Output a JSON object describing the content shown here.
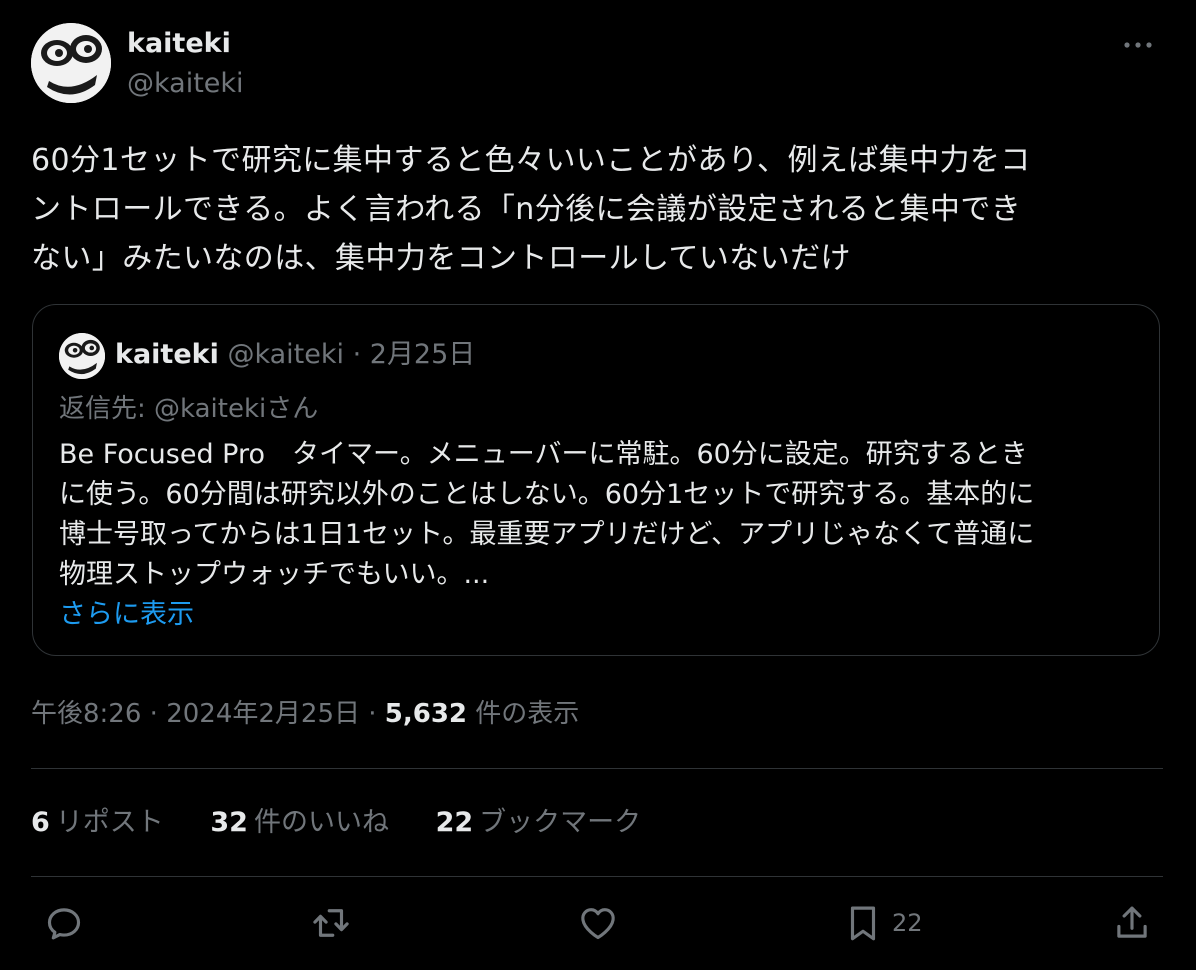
{
  "author": {
    "display_name": "kaiteki",
    "handle": "@kaiteki"
  },
  "tweet": {
    "lines": [
      "60分1セットで研究に集中すると色々いいことがあり、例えば集中力をコ",
      "ントロールできる。よく言われる「n分後に会議が設定されると集中でき",
      "ない」みたいなのは、集中力をコントロールしていないだけ"
    ]
  },
  "quote": {
    "display_name": "kaiteki",
    "meta": "@kaiteki · 2月25日",
    "reply_to": "返信先: @kaitekiさん",
    "lines": [
      "Be Focused Pro　タイマー。メニューバーに常駐。60分に設定。研究するとき",
      "に使う。60分間は研究以外のことはしない。60分1セットで研究する。基本的に",
      "博士号取ってからは1日1セット。最重要アプリだけど、アプリじゃなくて普通に",
      "物理ストップウォッチでもいい。..."
    ],
    "show_more": "さらに表示"
  },
  "meta": {
    "time": "午後8:26",
    "date": "2024年2月25日",
    "views_count": "5,632",
    "views_label": "件の表示"
  },
  "stats": {
    "reposts_count": "6",
    "reposts_label": "リポスト",
    "likes_count": "32",
    "likes_label": "件のいいね",
    "bookmarks_count": "22",
    "bookmarks_label": "ブックマーク"
  },
  "actions": {
    "reply_icon": "reply-icon",
    "repost_icon": "repost-icon",
    "like_icon": "heart-icon",
    "bookmark_icon": "bookmark-icon",
    "bookmark_count": "22",
    "share_icon": "share-icon"
  },
  "colors": {
    "background": "#000000",
    "text": "#e7e9ea",
    "secondary": "#71767b",
    "border": "#2f3336",
    "link": "#1d9bf0"
  }
}
